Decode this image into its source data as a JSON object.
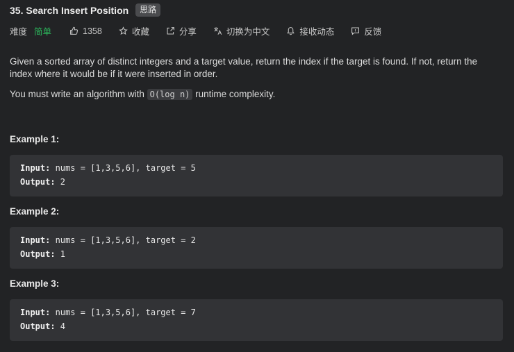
{
  "header": {
    "title": "35. Search Insert Position",
    "badge": "思路"
  },
  "meta": {
    "difficulty_label": "难度",
    "difficulty_value": "简单",
    "like_count": "1358",
    "favorite_label": "收藏",
    "share_label": "分享",
    "translate_label": "切换为中文",
    "subscribe_label": "接收动态",
    "feedback_label": "反馈"
  },
  "description": {
    "p1": "Given a sorted array of distinct integers and a target value, return the index if the target is found. If not, return the index where it would be if it were inserted in order.",
    "p2_before": "You must write an algorithm with ",
    "p2_code": "O(log n)",
    "p2_after": " runtime complexity."
  },
  "examples": [
    {
      "title": "Example 1:",
      "input_label": "Input:",
      "input": " nums = [1,3,5,6], target = 5",
      "output_label": "Output:",
      "output": " 2"
    },
    {
      "title": "Example 2:",
      "input_label": "Input:",
      "input": " nums = [1,3,5,6], target = 2",
      "output_label": "Output:",
      "output": " 1"
    },
    {
      "title": "Example 3:",
      "input_label": "Input:",
      "input": " nums = [1,3,5,6], target = 7",
      "output_label": "Output:",
      "output": " 4"
    }
  ],
  "colors": {
    "background": "#222325",
    "easy": "#2cbb5d",
    "code_bg": "#323336"
  }
}
